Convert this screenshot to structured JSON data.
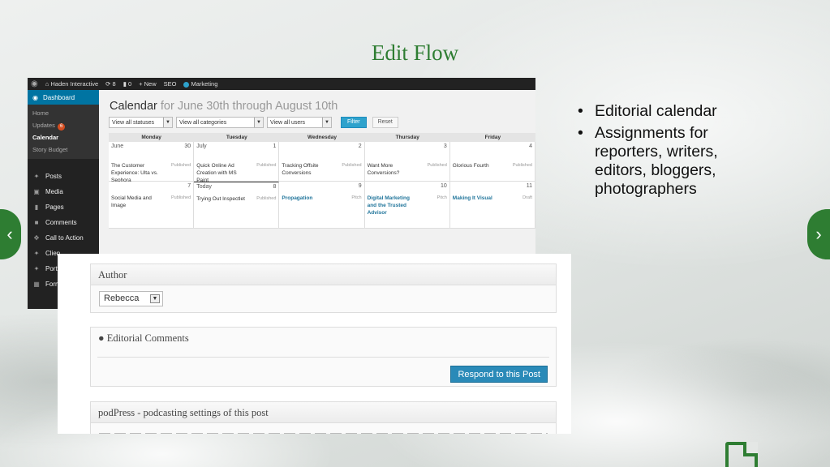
{
  "slide": {
    "title": "Edit Flow",
    "bullets": [
      "Editorial calendar",
      "Assignments for reporters, writers, editors, bloggers, photographers"
    ]
  },
  "adminbar": {
    "site": "Haden Interactive",
    "updates": "8",
    "comments": "0",
    "new": "New",
    "seo": "SEO",
    "marketing": "Marketing"
  },
  "sidebar": {
    "dashboard": "Dashboard",
    "sub": [
      "Home",
      "Updates",
      "Calendar",
      "Story Budget"
    ],
    "updates_badge": "6",
    "items": [
      "Posts",
      "Media",
      "Pages",
      "Comments",
      "Call to Action",
      "Clien",
      "Portf",
      "Form"
    ]
  },
  "calendar": {
    "heading": "Calendar",
    "range": "for June 30th through August 10th",
    "filters": {
      "statuses": "View all statuses",
      "categories": "View all categories",
      "users": "View all users",
      "filter_btn": "Filter",
      "reset_btn": "Reset"
    },
    "days": [
      "Monday",
      "Tuesday",
      "Wednesday",
      "Thursday",
      "Friday"
    ],
    "week1": [
      {
        "month": "June",
        "num": "30",
        "title": "The Customer Experience: Ulta vs. Sephora",
        "status": "Published"
      },
      {
        "month": "July",
        "num": "1",
        "title": "Quick Online Ad Creation with MS Paint",
        "status": "Published"
      },
      {
        "month": "",
        "num": "2",
        "title": "Tracking Offsite Conversions",
        "status": "Published"
      },
      {
        "month": "",
        "num": "3",
        "title": "Want More Conversions?",
        "status": "Published"
      },
      {
        "month": "",
        "num": "4",
        "title": "Glorious Fourth",
        "status": "Published"
      }
    ],
    "week2": [
      {
        "label": "",
        "num": "7",
        "title": "Social Media and Image",
        "status": "Published"
      },
      {
        "label": "Today",
        "num": "8",
        "title": "Trying Out Inspectlet",
        "status": "Published"
      },
      {
        "label": "",
        "num": "9",
        "title": "Propagation",
        "status": "Pitch"
      },
      {
        "label": "",
        "num": "10",
        "title": "Digital Marketing and the Trusted Advisor",
        "status": "Pitch"
      },
      {
        "label": "",
        "num": "11",
        "title": "Making It Visual",
        "status": "Draft"
      }
    ]
  },
  "postbox": {
    "author_title": "Author",
    "author_value": "Rebecca",
    "comments_title": "Editorial Comments",
    "respond_btn": "Respond to this Post",
    "podpress_title": "podPress - podcasting settings of this post"
  },
  "colors": {
    "accent": "#2e7d32",
    "wp_blue": "#2ea2cc",
    "admin_dark": "#222222"
  }
}
